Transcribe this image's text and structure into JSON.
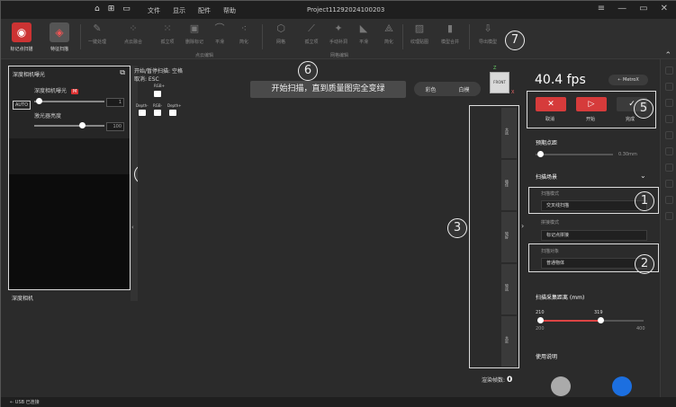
{
  "titlebar": {
    "menus": [
      "文件",
      "显示",
      "配件",
      "帮助"
    ],
    "project": "Project112920241002​03",
    "window_controls": [
      "≡",
      "—",
      "▭",
      "✕"
    ]
  },
  "toolbar": {
    "scan_modes": [
      {
        "label": "标记点扫描",
        "icon": "marker-scan-icon"
      },
      {
        "label": "特征扫描",
        "icon": "feature-scan-icon"
      }
    ],
    "tools": [
      "一键处理",
      "点云融合",
      "孤立项",
      "删除标记",
      "平滑",
      "简化",
      "网格",
      "孤立项",
      "手动补洞",
      "平滑",
      "简化",
      "纹理贴图",
      "模型合并",
      "导出模型"
    ],
    "group_pointcloud": "点云编辑",
    "group_mesh": "网格编辑"
  },
  "left_panel": {
    "title": "深度相机曝光",
    "exposure_label": "深度相机曝光",
    "exposure_mode": "M",
    "exposure_value": "1",
    "auto_label": "AUTO",
    "laser_label": "激光器亮度",
    "laser_value": "100",
    "camera_label": "深度相机",
    "collapse_glyph": "‹"
  },
  "viewport": {
    "shortcut_line1": "开始/暂停扫描: 空格",
    "shortcut_line2": "取消: ESC",
    "keys": [
      "RGB+",
      "Depth-",
      "RGB-",
      "Depth+"
    ],
    "hint": "开始扫描，直到质量图完全变绿",
    "toggle_color": "彩色",
    "toggle_white": "白模",
    "cube_label": "FRONT",
    "axis_z": "Z",
    "axis_x": "X",
    "frames": [
      "太远",
      "极佳",
      "较好",
      "较远",
      "太近"
    ],
    "render_count_label": "渲染帧数:",
    "render_count_value": "0",
    "expand_glyph": "›"
  },
  "right_panel": {
    "fps": "40.4 fps",
    "metrox": "MetroX",
    "cancel_label": "取消",
    "start_label": "开始",
    "finish_label": "完成",
    "point_distance_title": "预期点距",
    "point_distance_value": "0.30mm",
    "scan_scene_title": "扫描场景",
    "scan_mode_label": "扫描模式",
    "scan_mode_value": "交叉线扫描",
    "align_mode_label": "拼接模式",
    "align_mode_value": "标记点拼接",
    "scan_object_label": "扫描对象",
    "scan_object_value": "普通物体",
    "range_title": "扫描采集距离 (mm)",
    "range_low": "210",
    "range_high": "319",
    "range_min": "200",
    "range_max": "400",
    "usage_title": "使用说明"
  },
  "annotations": [
    "1",
    "2",
    "3",
    "4",
    "5",
    "6",
    "7"
  ],
  "statusbar": {
    "usb": "USB 已连接"
  },
  "colors": {
    "accent": "#d63b3b",
    "panel": "#2b2b2b",
    "metrox": "#3c3c3c"
  }
}
